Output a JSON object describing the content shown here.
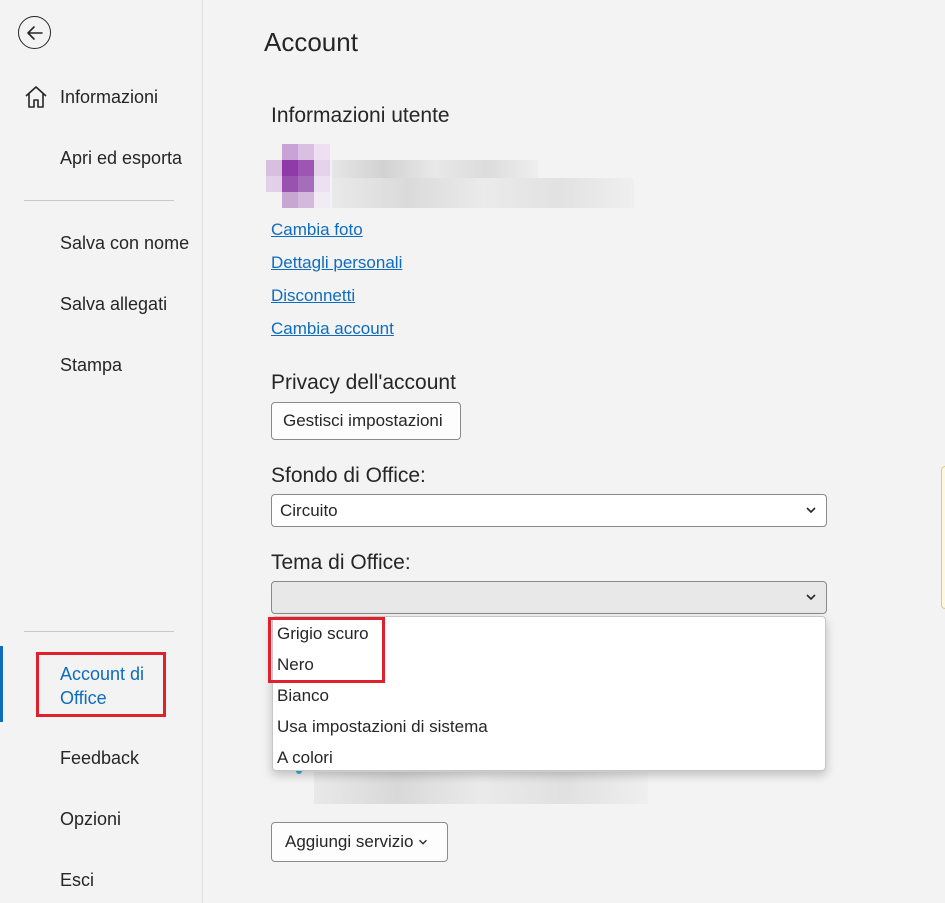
{
  "sidebar": {
    "items": [
      {
        "label": "Informazioni"
      },
      {
        "label": "Apri ed esporta"
      },
      {
        "label": "Salva con nome"
      },
      {
        "label": "Salva allegati"
      },
      {
        "label": "Stampa"
      },
      {
        "label": "Account di Office"
      },
      {
        "label": "Feedback"
      },
      {
        "label": "Opzioni"
      },
      {
        "label": "Esci"
      }
    ]
  },
  "main": {
    "title": "Account",
    "user_info": {
      "heading": "Informazioni utente",
      "links": [
        "Cambia foto",
        "Dettagli personali",
        "Disconnetti",
        "Cambia account"
      ]
    },
    "privacy": {
      "heading": "Privacy dell'account",
      "button_label": "Gestisci impostazioni"
    },
    "background": {
      "heading": "Sfondo di Office:",
      "selected": "Circuito"
    },
    "theme": {
      "heading": "Tema di Office:",
      "selected": "",
      "options": [
        "Grigio scuro",
        "Nero",
        "Bianco",
        "Usa impostazioni di sistema",
        "A colori"
      ]
    },
    "services": {
      "add_button_label": "Aggiungi servizio"
    }
  },
  "colors": {
    "accent": "#0f6cbd",
    "highlight": "#e0202a",
    "avatar_purple": "#8e3ba7"
  }
}
